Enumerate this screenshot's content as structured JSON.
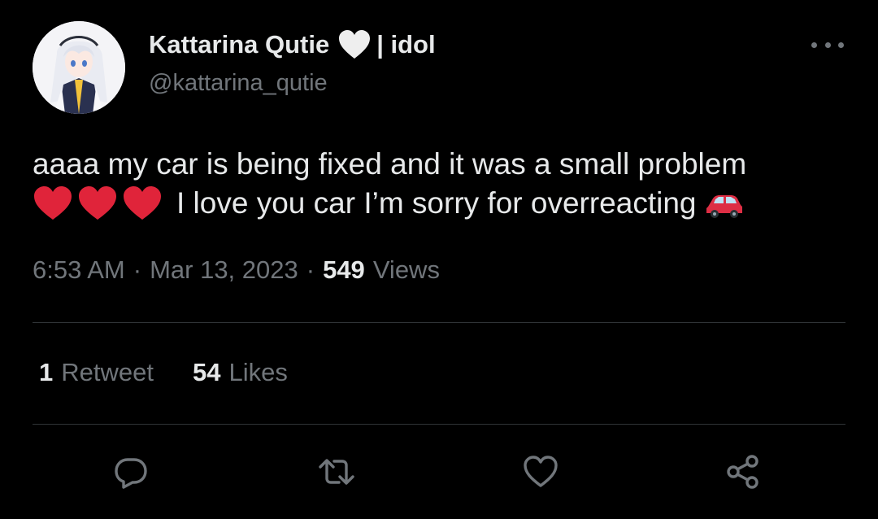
{
  "author": {
    "display_name": "Kattarina Qutie",
    "name_suffix": "| idol",
    "handle": "@kattarina_qutie"
  },
  "tweet": {
    "text_line1": "aaaa my car is being fixed and it was a small problem",
    "text_line2": "I love you car I’m sorry for overreacting"
  },
  "meta": {
    "time": "6:53 AM",
    "separator": "·",
    "date": "Mar 13, 2023",
    "views_count": "549",
    "views_label": "Views"
  },
  "stats": {
    "retweets_count": "1",
    "retweets_label": "Retweet",
    "likes_count": "54",
    "likes_label": "Likes"
  },
  "icons": {
    "reply": "reply-icon",
    "retweet": "retweet-icon",
    "like": "heart-icon",
    "share": "share-icon",
    "more": "more-icon"
  },
  "colors": {
    "background": "#000000",
    "text_primary": "#e7e9ea",
    "text_secondary": "#71767b",
    "divider": "#2f3336",
    "heart_red": "#e0243a",
    "car_red": "#dd2e44"
  }
}
